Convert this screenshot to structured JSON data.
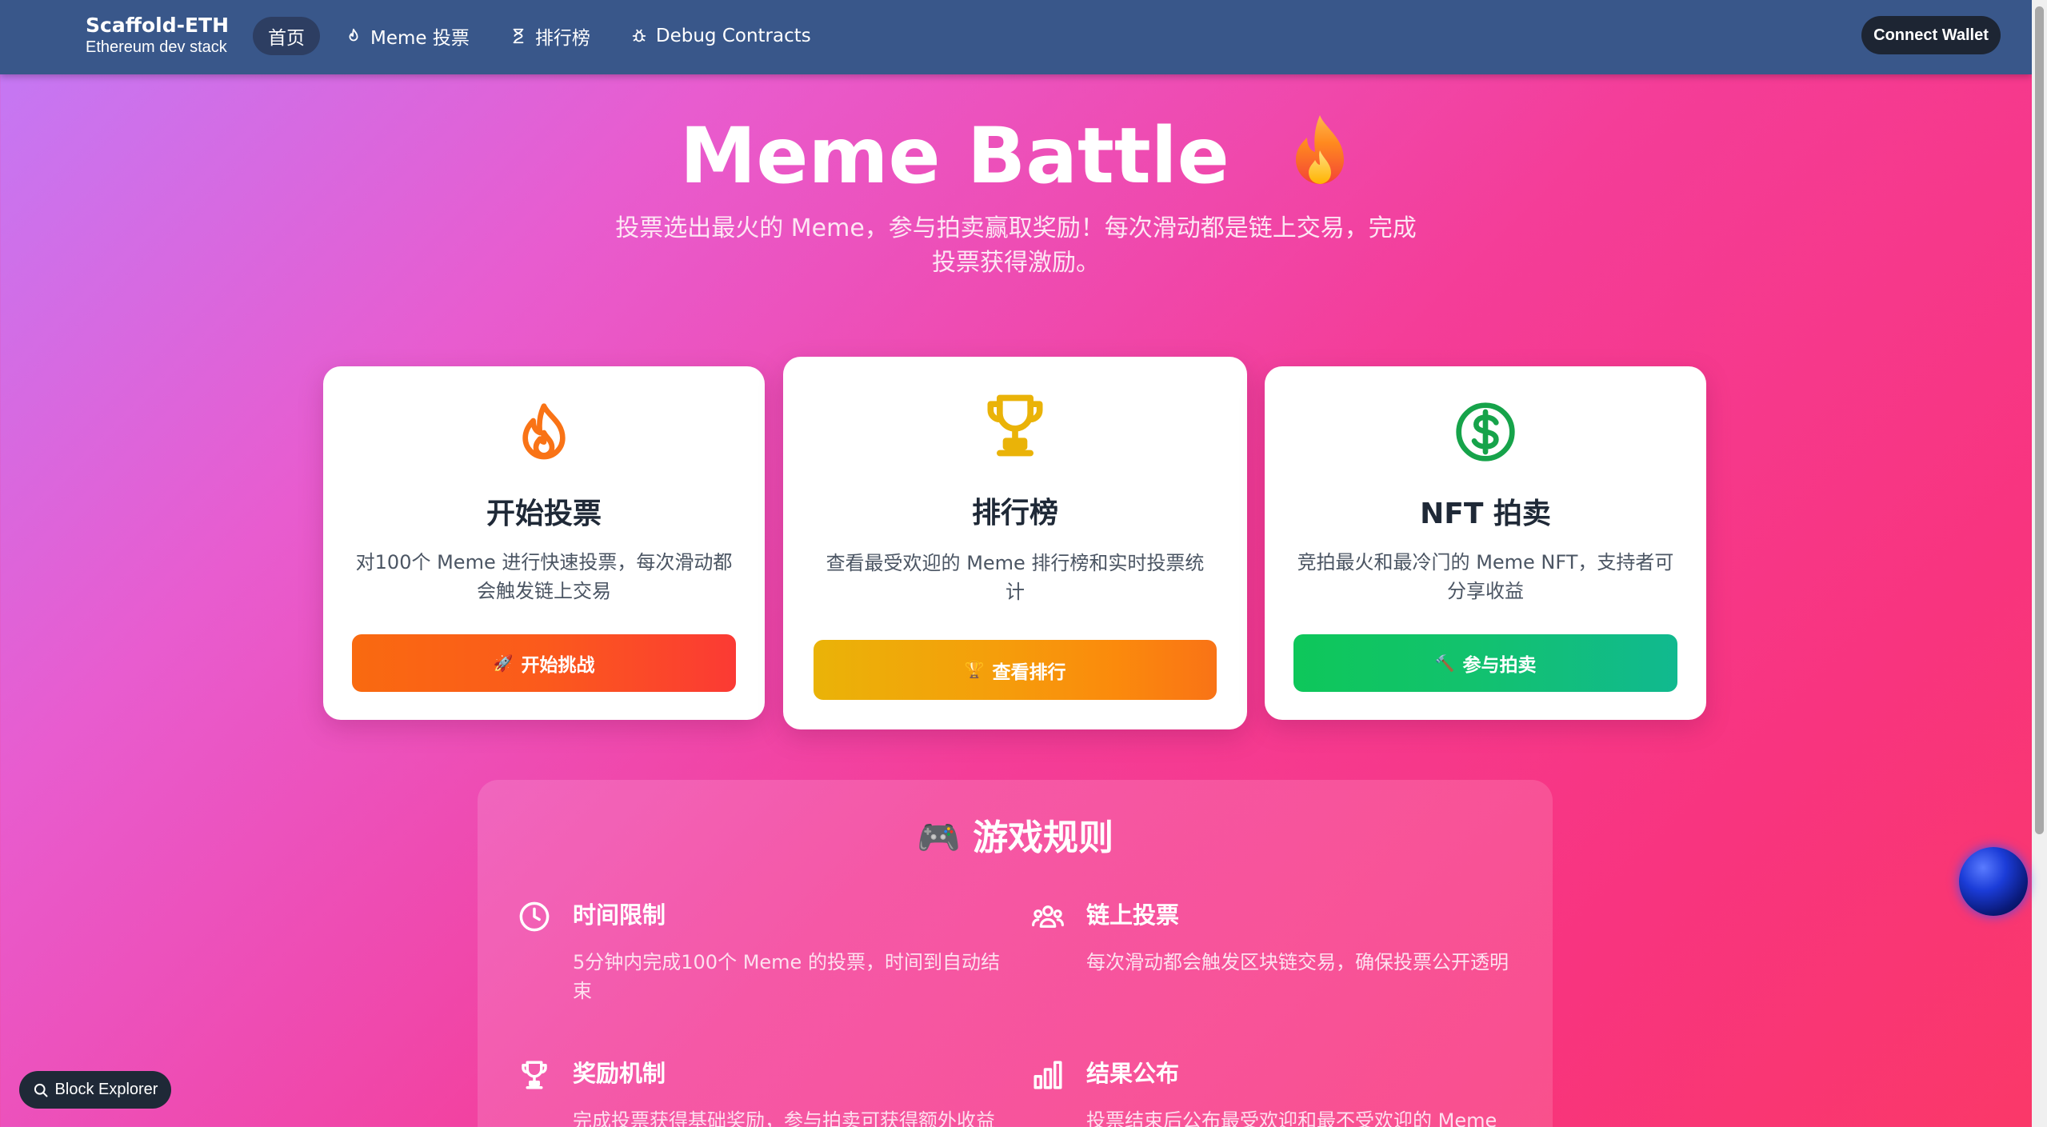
{
  "navbar": {
    "brand_title": "Scaffold-ETH",
    "brand_subtitle": "Ethereum dev stack",
    "items": [
      {
        "label": "首页",
        "icon": "none",
        "active": true
      },
      {
        "label": "Meme 投票",
        "icon": "flame-icon",
        "active": false
      },
      {
        "label": "排行榜",
        "icon": "hourglass-icon",
        "active": false
      },
      {
        "label": "Debug Contracts",
        "icon": "bug-icon",
        "active": false
      }
    ],
    "connect_label": "Connect Wallet"
  },
  "hero": {
    "title": "Meme Battle",
    "emoji": "🔥",
    "subtitle_line1": "投票选出最火的 Meme，参与拍卖赢取奖励！每次滑动都是链上交易，完成",
    "subtitle_line2": "投票获得激励。"
  },
  "cards": [
    {
      "title": "开始投票",
      "desc_line1": "对100个 Meme 进行快速投票，每次滑动都",
      "desc_line2": "会触发链上交易",
      "button": "开始挑战",
      "button_emoji": "🚀",
      "icon": "flame-icon",
      "accent": "#f97316"
    },
    {
      "title": "排行榜",
      "desc_line1": "查看最受欢迎的 Meme 排行榜和实时投票统",
      "desc_line2": "计",
      "button": "查看排行",
      "button_emoji": "🏆",
      "icon": "trophy-icon",
      "accent": "#eab308"
    },
    {
      "title": "NFT 拍卖",
      "desc_line1": "竞拍最火和最冷门的 Meme NFT，支持者可",
      "desc_line2": "分享收益",
      "button": "参与拍卖",
      "button_emoji": "🔨",
      "icon": "dollar-icon",
      "accent": "#16a34a"
    }
  ],
  "rules": {
    "title": "游戏规则",
    "title_emoji": "🎮",
    "items": [
      {
        "head": "时间限制",
        "text_line1": "5分钟内完成100个 Meme 的投票，时间到自动结",
        "text_line2": "束",
        "icon": "clock-icon"
      },
      {
        "head": "链上投票",
        "text_line1": "每次滑动都会触发区块链交易，确保投票公开透明",
        "text_line2": "",
        "icon": "users-icon"
      },
      {
        "head": "奖励机制",
        "text_line1": "完成投票获得基础奖励，参与拍卖可获得额外收益",
        "text_line2": "",
        "icon": "trophy-icon"
      },
      {
        "head": "结果公布",
        "text_line1": "投票结束后公布最受欢迎和最不受欢迎的 Meme",
        "text_line2": "",
        "icon": "bar-chart-icon"
      }
    ]
  },
  "block_explorer": "Block Explorer"
}
